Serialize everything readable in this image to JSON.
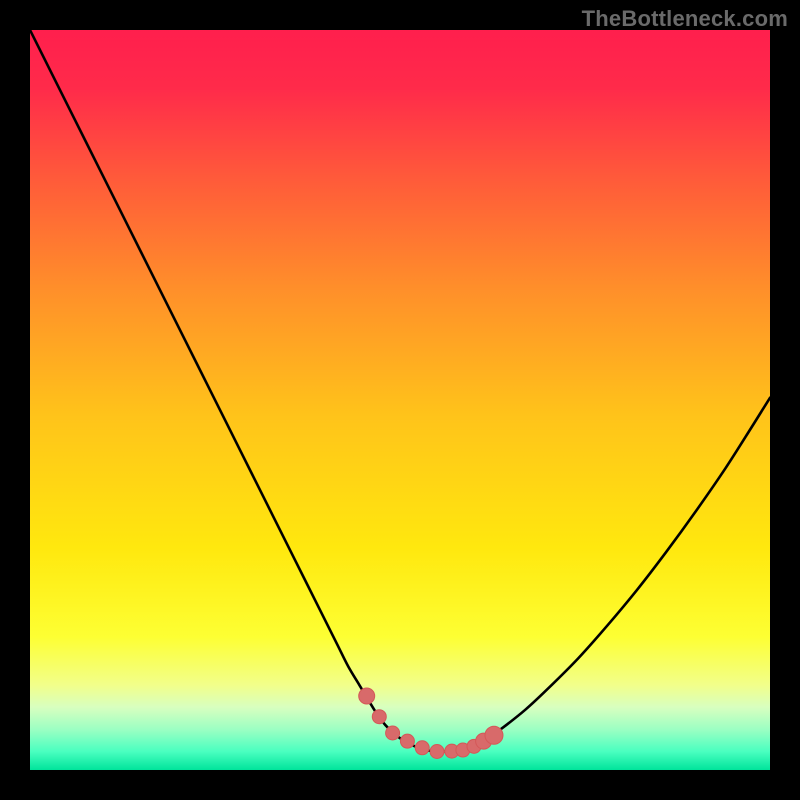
{
  "watermark": "TheBottleneck.com",
  "colors": {
    "frame": "#000000",
    "curve": "#000000",
    "marker_fill": "#d86a6a",
    "marker_edge": "#d45858",
    "gradient_stops": [
      {
        "offset": 0.0,
        "color": "#ff1f4d"
      },
      {
        "offset": 0.08,
        "color": "#ff2b4a"
      },
      {
        "offset": 0.2,
        "color": "#ff5a3a"
      },
      {
        "offset": 0.35,
        "color": "#ff8f2a"
      },
      {
        "offset": 0.52,
        "color": "#ffc31a"
      },
      {
        "offset": 0.7,
        "color": "#ffe80e"
      },
      {
        "offset": 0.82,
        "color": "#fdff33"
      },
      {
        "offset": 0.885,
        "color": "#f2ff8a"
      },
      {
        "offset": 0.915,
        "color": "#d8ffbf"
      },
      {
        "offset": 0.945,
        "color": "#9cffc3"
      },
      {
        "offset": 0.975,
        "color": "#4affc0"
      },
      {
        "offset": 1.0,
        "color": "#00e49b"
      }
    ]
  },
  "chart_data": {
    "type": "line",
    "title": "",
    "xlabel": "",
    "ylabel": "",
    "xlim": [
      0,
      100
    ],
    "ylim": [
      0,
      100
    ],
    "grid": false,
    "legend": false,
    "series": [
      {
        "name": "curve",
        "x": [
          0,
          3,
          6,
          9,
          12,
          15,
          18,
          21,
          24,
          27,
          30,
          33,
          36,
          39,
          41.5,
          43,
          44.5,
          46,
          47,
          48,
          49,
          50,
          51,
          52,
          53,
          54,
          55,
          56,
          57,
          58,
          59,
          60.5,
          62,
          64,
          67,
          70,
          74,
          78,
          82,
          86,
          90,
          94,
          97.5,
          100
        ],
        "y": [
          100,
          94,
          88,
          82,
          76,
          70,
          64,
          58,
          52,
          46,
          40,
          34,
          28,
          22,
          17,
          14,
          11.5,
          9,
          7.4,
          6.1,
          5.1,
          4.3,
          3.7,
          3.2,
          2.85,
          2.6,
          2.5,
          2.5,
          2.55,
          2.7,
          3.0,
          3.6,
          4.4,
          5.8,
          8.2,
          11,
          15,
          19.5,
          24.3,
          29.5,
          35.0,
          40.8,
          46.3,
          50.3
        ]
      }
    ],
    "markers": {
      "name": "highlight-points",
      "x": [
        45.5,
        47.2,
        49.0,
        51.0,
        53.0,
        55.0,
        57.0,
        58.5,
        60.0,
        61.3,
        62.7
      ],
      "y": [
        10.0,
        7.2,
        5.0,
        3.9,
        3.0,
        2.5,
        2.55,
        2.7,
        3.2,
        3.9,
        4.7
      ],
      "r": [
        8,
        7,
        7,
        7,
        7,
        7,
        7,
        7,
        7,
        8,
        9
      ]
    }
  }
}
